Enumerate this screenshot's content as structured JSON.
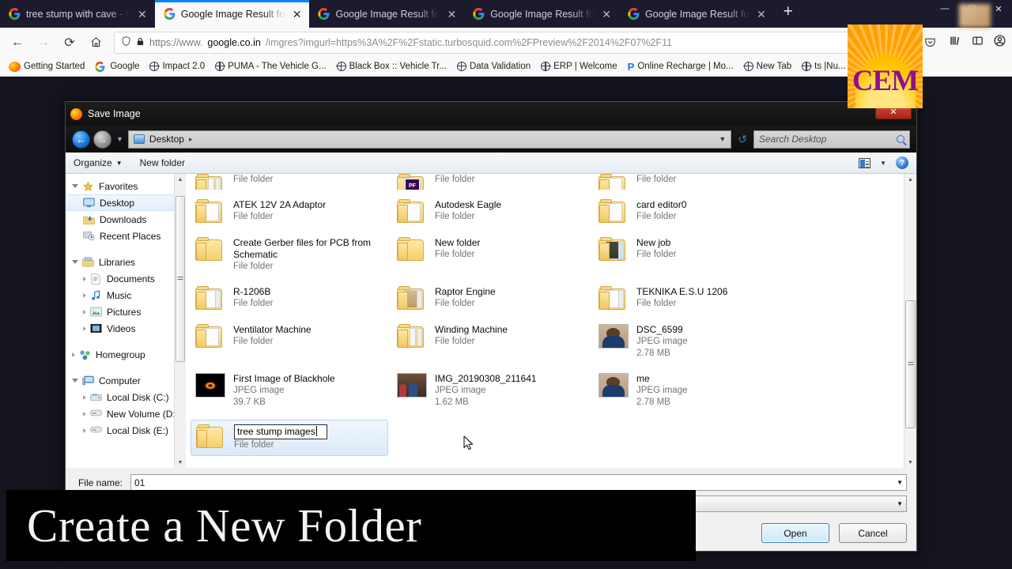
{
  "browser": {
    "tabs": [
      {
        "label": "tree stump with cave - Go",
        "active": false
      },
      {
        "label": "Google Image Result for h",
        "active": true
      },
      {
        "label": "Google Image Result for h",
        "active": false
      },
      {
        "label": "Google Image Result for h",
        "active": false
      },
      {
        "label": "Google Image Result for h",
        "active": false
      }
    ],
    "new_tab_glyph": "+",
    "close_glyph": "✕",
    "window_controls": [
      "—",
      "❐",
      "✕"
    ],
    "nav": {
      "back": "←",
      "forward": "→",
      "reload": "⟳",
      "home": "⌂"
    },
    "url": {
      "shield_icon": "shield",
      "lock_icon": "🔒",
      "prefix": "https://www.",
      "host": "google.co.in",
      "tail": "/imgres?imgurl=https%3A%2F%2Fstatic.turbosquid.com%2FPreview%2F2014%2F07%2F11",
      "menu_dots": "•••",
      "pocket": "▽"
    },
    "toolbar_icons": [
      "library-icon",
      "sidebar-icon",
      "account-icon"
    ],
    "bookmarks": [
      {
        "label": "Getting Started",
        "icon": "firefox"
      },
      {
        "label": "Google",
        "icon": "google"
      },
      {
        "label": "Impact 2.0",
        "icon": "globe"
      },
      {
        "label": "PUMA - The Vehicle G...",
        "icon": "globe"
      },
      {
        "label": "Black Box :: Vehicle Tr...",
        "icon": "globe"
      },
      {
        "label": "Data Validation",
        "icon": "globe"
      },
      {
        "label": "ERP | Welcome",
        "icon": "globe"
      },
      {
        "label": "Online Recharge | Mo...",
        "icon": "pocket-p"
      },
      {
        "label": "New Tab",
        "icon": "globe"
      },
      {
        "label": "ts |Nu...",
        "icon": "globe"
      }
    ]
  },
  "dialog": {
    "title": "Save Image",
    "app_icon": "firefox-icon",
    "close_label": "✕",
    "breadcrumb": "Desktop",
    "breadcrumb_sep": "▸",
    "search_placeholder": "Search Desktop",
    "toolbar": {
      "organize": "Organize",
      "organize_caret": "▼",
      "new_folder": "New folder",
      "view_caret": "▼",
      "help": "?"
    },
    "sidebar": [
      {
        "label": "Favorites",
        "icon": "star-icon",
        "level": 0,
        "expander": "open",
        "selected": false
      },
      {
        "label": "Desktop",
        "icon": "desktop-icon",
        "level": 1,
        "expander": "none",
        "selected": true
      },
      {
        "label": "Downloads",
        "icon": "downloads-icon",
        "level": 1,
        "expander": "none",
        "selected": false
      },
      {
        "label": "Recent Places",
        "icon": "recent-places-icon",
        "level": 1,
        "expander": "none",
        "selected": false
      },
      {
        "label": "",
        "icon": "spacer",
        "level": 0,
        "expander": "none",
        "selected": false
      },
      {
        "label": "Libraries",
        "icon": "libraries-icon",
        "level": 0,
        "expander": "open",
        "selected": false
      },
      {
        "label": "Documents",
        "icon": "documents-icon",
        "level": 1,
        "expander": "closed",
        "selected": false
      },
      {
        "label": "Music",
        "icon": "music-icon",
        "level": 1,
        "expander": "closed",
        "selected": false
      },
      {
        "label": "Pictures",
        "icon": "pictures-icon",
        "level": 1,
        "expander": "closed",
        "selected": false
      },
      {
        "label": "Videos",
        "icon": "videos-icon",
        "level": 1,
        "expander": "closed",
        "selected": false
      },
      {
        "label": "",
        "icon": "spacer",
        "level": 0,
        "expander": "none",
        "selected": false
      },
      {
        "label": "Homegroup",
        "icon": "homegroup-icon",
        "level": 0,
        "expander": "closed",
        "selected": false
      },
      {
        "label": "",
        "icon": "spacer",
        "level": 0,
        "expander": "none",
        "selected": false
      },
      {
        "label": "Computer",
        "icon": "computer-icon",
        "level": 0,
        "expander": "open",
        "selected": false
      },
      {
        "label": "Local Disk (C:)",
        "icon": "local-disk-icon",
        "level": 1,
        "expander": "closed",
        "selected": false
      },
      {
        "label": "New Volume (D:)",
        "icon": "drive-icon",
        "level": 1,
        "expander": "closed",
        "selected": false
      },
      {
        "label": "Local Disk (E:)",
        "icon": "drive-icon",
        "level": 1,
        "expander": "closed",
        "selected": false
      }
    ],
    "files": [
      [
        {
          "name": "",
          "type": "File folder",
          "size": "",
          "icon": "folder-multi",
          "partial": true
        },
        {
          "name": "",
          "type": "File folder",
          "size": "",
          "icon": "folder-pf",
          "partial": true
        },
        {
          "name": "",
          "type": "File folder",
          "size": "",
          "icon": "folder-doc",
          "partial": true
        }
      ],
      [
        {
          "name": "ATEK 12V 2A Adaptor",
          "type": "File folder",
          "size": "",
          "icon": "folder-doc"
        },
        {
          "name": "Autodesk Eagle",
          "type": "File folder",
          "size": "",
          "icon": "folder-plain"
        },
        {
          "name": "card editor0",
          "type": "File folder",
          "size": "",
          "icon": "folder-doc"
        }
      ],
      [
        {
          "name": "Create Gerber files for PCB from Schematic",
          "type": "File folder",
          "size": "",
          "icon": "folder-plain"
        },
        {
          "name": "New folder",
          "type": "File folder",
          "size": "",
          "icon": "folder-plain"
        },
        {
          "name": "New job",
          "type": "File folder",
          "size": "",
          "icon": "folder-multi"
        }
      ],
      [
        {
          "name": "R-1206B",
          "type": "File folder",
          "size": "",
          "icon": "folder-doc"
        },
        {
          "name": "Raptor Engine",
          "type": "File folder",
          "size": "",
          "icon": "folder-doc"
        },
        {
          "name": "TEKNIKA E.S.U 1206",
          "type": "File folder",
          "size": "",
          "icon": "folder-doc"
        }
      ],
      [
        {
          "name": "Ventilator Machine",
          "type": "File folder",
          "size": "",
          "icon": "folder-doc"
        },
        {
          "name": "Winding Machine",
          "type": "File folder",
          "size": "",
          "icon": "folder-multi"
        },
        {
          "name": "DSC_6599",
          "type": "JPEG image",
          "size": "2.78 MB",
          "icon": "thumb-person"
        }
      ],
      [
        {
          "name": "First Image of Blackhole",
          "type": "JPEG image",
          "size": "39.7 KB",
          "icon": "thumb-blackhole"
        },
        {
          "name": "IMG_20190308_211641",
          "type": "JPEG image",
          "size": "1.62 MB",
          "icon": "thumb-group"
        },
        {
          "name": "me",
          "type": "JPEG image",
          "size": "2.78 MB",
          "icon": "thumb-person"
        }
      ]
    ],
    "renaming_item": {
      "value": "tree stump images",
      "type": "File folder",
      "icon": "folder-plain"
    },
    "footer": {
      "file_name_label": "File name:",
      "file_name_value": "01",
      "save_as_type_value": "",
      "caret": "▼",
      "open_button": "Open",
      "cancel_button": "Cancel"
    }
  },
  "overlays": {
    "banner_text": "Create a New Folder",
    "logo_text": "CEM"
  }
}
